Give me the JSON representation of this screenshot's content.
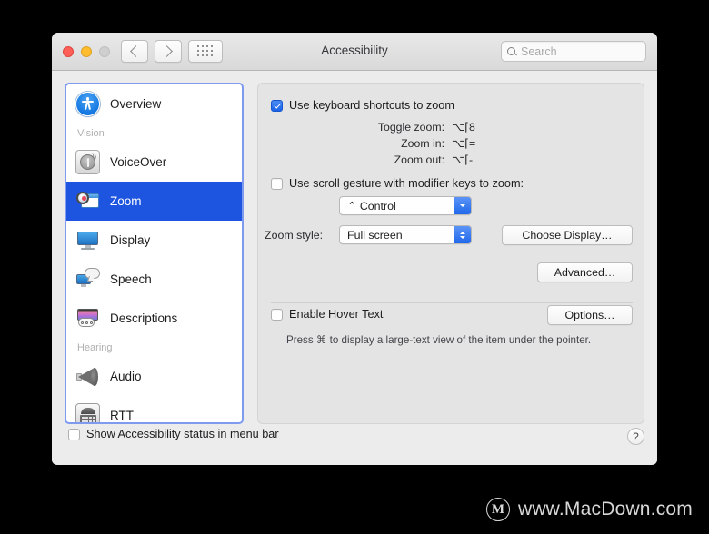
{
  "window": {
    "title": "Accessibility",
    "traffic_lights": [
      "close-red",
      "minimize-yellow",
      "zoom-disabled-gray"
    ],
    "nav": {
      "back_icon": "chevron-left-icon",
      "forward_icon": "chevron-right-icon",
      "grid_icon": "grid-view-icon"
    },
    "search": {
      "placeholder": "Search",
      "value": "",
      "icon": "search-icon"
    }
  },
  "sidebar": {
    "items": [
      {
        "type": "item",
        "label": "Overview",
        "icon": "accessibility-person-icon",
        "selected": false
      },
      {
        "type": "section",
        "label": "Vision"
      },
      {
        "type": "item",
        "label": "VoiceOver",
        "icon": "voiceover-icon",
        "selected": false
      },
      {
        "type": "item",
        "label": "Zoom",
        "icon": "zoom-magnifier-icon",
        "selected": true
      },
      {
        "type": "item",
        "label": "Display",
        "icon": "display-monitor-icon",
        "selected": false
      },
      {
        "type": "item",
        "label": "Speech",
        "icon": "speech-bubble-icon",
        "selected": false
      },
      {
        "type": "item",
        "label": "Descriptions",
        "icon": "descriptions-icon",
        "selected": false
      },
      {
        "type": "section",
        "label": "Hearing"
      },
      {
        "type": "item",
        "label": "Audio",
        "icon": "speaker-icon",
        "selected": false
      },
      {
        "type": "item",
        "label": "RTT",
        "icon": "rtt-teletype-icon",
        "selected": false
      }
    ]
  },
  "panel": {
    "keyboard_shortcuts": {
      "checkbox_label": "Use keyboard shortcuts to zoom",
      "checked": true,
      "rows": [
        {
          "label": "Toggle zoom:",
          "value": "⌥⌈8"
        },
        {
          "label": "Zoom in:",
          "value": "⌥⌈="
        },
        {
          "label": "Zoom out:",
          "value": "⌥⌈-"
        }
      ]
    },
    "scroll_gesture": {
      "checkbox_label": "Use scroll gesture with modifier keys to zoom:",
      "checked": false,
      "modifier_value": "⌃ Control",
      "modifier_arrow": "chevron-down-icon"
    },
    "zoom_style": {
      "label": "Zoom style:",
      "value": "Full screen",
      "arrow": "up-down-arrows-icon"
    },
    "choose_display_button": "Choose Display…",
    "advanced_button": "Advanced…",
    "hover_text": {
      "checkbox_label": "Enable Hover Text",
      "checked": false,
      "options_button": "Options…",
      "hint": "Press ⌘ to display a large-text view of the item under the pointer."
    }
  },
  "bottom": {
    "checkbox_label": "Show Accessibility status in menu bar",
    "checked": false,
    "help_glyph": "?"
  },
  "watermark": {
    "logo_letter": "M",
    "text": "www.MacDown.com"
  },
  "colors": {
    "selection_blue": "#1d55e0",
    "focus_ring": "#7f9bf0",
    "checkbox_blue": "#1a63e8",
    "window_bg": "#ececec",
    "panel_bg": "#e4e4e4"
  }
}
